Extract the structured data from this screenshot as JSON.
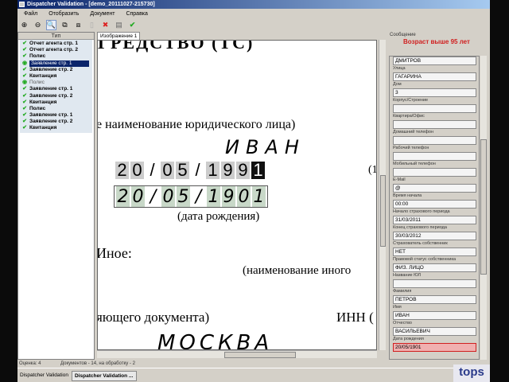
{
  "window": {
    "title": "Dispatcher Validation - [demo_20111027-215730]"
  },
  "menu": [
    "Файл",
    "Отобразить",
    "Документ",
    "Справка"
  ],
  "left_panel": {
    "header": "Тип",
    "items": [
      {
        "label": "Отчет агента стр. 1",
        "state": "ok"
      },
      {
        "label": "Отчет агента стр. 2",
        "state": "ok"
      },
      {
        "label": "Полис",
        "state": "ok"
      },
      {
        "label": "Заявление стр. 1",
        "state": "selected"
      },
      {
        "label": "Заявление стр. 2",
        "state": "ok"
      },
      {
        "label": "Квитанция",
        "state": "ok"
      },
      {
        "label": "Полис",
        "state": "viewing"
      },
      {
        "label": "Заявление стр. 1",
        "state": "ok"
      },
      {
        "label": "Заявление стр. 2",
        "state": "ok"
      },
      {
        "label": "Квитанция",
        "state": "ok"
      },
      {
        "label": "Полис",
        "state": "ok"
      },
      {
        "label": "Заявление стр. 1",
        "state": "ok"
      },
      {
        "label": "Заявление стр. 2",
        "state": "ok"
      },
      {
        "label": "Квитанция",
        "state": "ok"
      }
    ]
  },
  "image_tab": "Изображение 1",
  "document": {
    "heading": "ГРЕДСТВО (ТС)",
    "legal_name": "е наименование юридического лица)",
    "hw_name": "ИВАН",
    "printed_digits": [
      "2",
      "0",
      "/",
      "0",
      "5",
      "/",
      "1",
      "9",
      "9",
      "1"
    ],
    "side_mark": "(1",
    "hw_digits": [
      "2",
      "0",
      "/",
      "0",
      "5",
      "/",
      "1",
      "9",
      "0",
      "1"
    ],
    "dob_caption": "(дата рождения)",
    "other": "Иное:",
    "other_caption": "(наименование иного",
    "doc_caption": "яющего документа)",
    "inn": "ИНН (",
    "hw_city": "МОСКВА"
  },
  "right_panel": {
    "message_label": "Сообщение",
    "message": "Возраст выше 95 лет",
    "fields": [
      {
        "label": "",
        "value": "ДМИТРОВ"
      },
      {
        "label": "Улица",
        "value": "ГАГАРИНА"
      },
      {
        "label": "Дом",
        "value": "3"
      },
      {
        "label": "Корпус/Строение",
        "value": ""
      },
      {
        "label": "Квартира/Офис",
        "value": ""
      },
      {
        "label": "Домашний телефон",
        "value": ""
      },
      {
        "label": "Рабочий телефон",
        "value": ""
      },
      {
        "label": "Мобильный телефон",
        "value": ""
      },
      {
        "label": "E-Mail",
        "value": "@"
      },
      {
        "label": "Время начала",
        "value": "00:00"
      },
      {
        "label": "Начало страхового периода",
        "value": "31/03/2011"
      },
      {
        "label": "Конец страхового периода",
        "value": "30/03/2012"
      },
      {
        "label": "Страхователь собственник",
        "value": "НЕТ"
      },
      {
        "label": "Правовой статус собственника",
        "value": "ФИЗ. ЛИЦО"
      },
      {
        "label": "Название ЮЛ",
        "value": ""
      },
      {
        "label": "Фамилия",
        "value": "ПЕТРОВ"
      },
      {
        "label": "Имя",
        "value": "ИВАН"
      },
      {
        "label": "Отчество",
        "value": "ВАСИЛЬЕВИЧ"
      },
      {
        "label": "Дата рождения",
        "value": "20/05/1901"
      }
    ]
  },
  "status": {
    "score": "Оценка: 4",
    "docs": "Документов - 14, на обработку - 2"
  },
  "taskbar": {
    "task1": "Dispatcher Validation for ...",
    "task2": "Dispatcher Validation ..."
  },
  "logo": "tops"
}
